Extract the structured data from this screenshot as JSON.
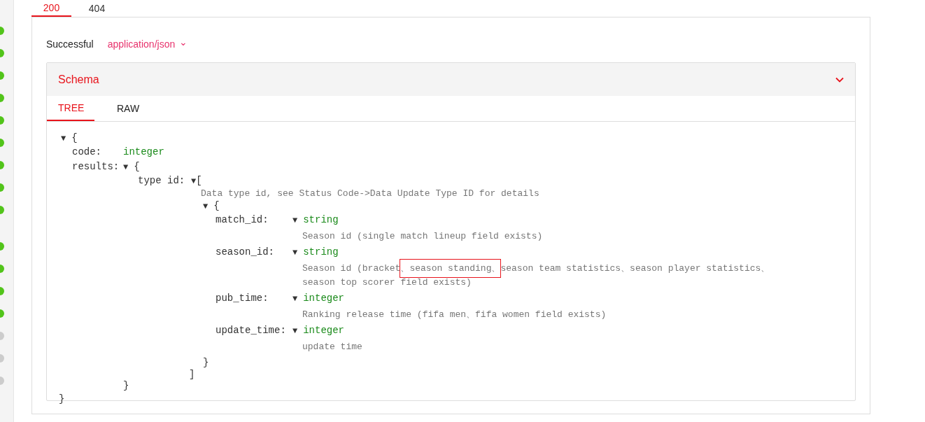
{
  "sidebar": {
    "dots": [
      {
        "color": "#52c41a"
      },
      {
        "color": "#52c41a"
      },
      {
        "color": "#52c41a"
      },
      {
        "color": "#52c41a"
      },
      {
        "color": "#52c41a"
      },
      {
        "color": "#52c41a"
      },
      {
        "color": "#52c41a"
      },
      {
        "color": "#52c41a"
      },
      {
        "color": "#52c41a"
      },
      {
        "color": "#52c41a"
      },
      {
        "color": "#52c41a"
      },
      {
        "color": "#52c41a"
      },
      {
        "color": "#52c41a"
      },
      {
        "color": "#cccccc"
      },
      {
        "color": "#cccccc"
      },
      {
        "color": "#cccccc"
      }
    ]
  },
  "response_tabs": [
    {
      "label": "200",
      "selected": true
    },
    {
      "label": "404",
      "selected": false
    }
  ],
  "response": {
    "status_text": "Successful",
    "content_type": "application/json",
    "content_type_caret": "⌄"
  },
  "schema": {
    "title": "Schema",
    "expanded": true,
    "view_tabs": [
      {
        "label": "TREE",
        "selected": true
      },
      {
        "label": "RAW",
        "selected": false
      }
    ],
    "tree": {
      "toggle": "▼",
      "open": "{",
      "close": "}",
      "fields": [
        {
          "kind": "scalar",
          "key": "code:",
          "type": "integer"
        },
        {
          "kind": "object",
          "key": "results:",
          "toggle": "▼",
          "open": "{",
          "close": "}",
          "fields": [
            {
              "kind": "array",
              "key": "type id:",
              "toggle": "▼",
              "open": "[",
              "close": "]",
              "description": [
                {
                  "text": "Data type id, see Status Code->Data Update Type ID for details",
                  "highlighted": false
                }
              ],
              "item": {
                "toggle": "▼",
                "open": "{",
                "close": "}",
                "fields": [
                  {
                    "kind": "scalar",
                    "key": "match_id:",
                    "toggle": "▼",
                    "type": "string",
                    "description": [
                      {
                        "text": "Season id (single match lineup field exists)",
                        "highlighted": false
                      }
                    ]
                  },
                  {
                    "kind": "scalar",
                    "key": "season_id:",
                    "toggle": "▼",
                    "type": "string",
                    "description": [
                      {
                        "text": "Season id (bracket",
                        "highlighted": false
                      },
                      {
                        "text": "、season standing、",
                        "highlighted": true
                      },
                      {
                        "text": "season team statistics、season player statistics、season top scorer field exists)",
                        "highlighted": false
                      }
                    ]
                  },
                  {
                    "kind": "scalar",
                    "key": "pub_time:",
                    "toggle": "▼",
                    "type": "integer",
                    "description": [
                      {
                        "text": "Ranking release time (fifa men、fifa women field exists)",
                        "highlighted": false
                      }
                    ]
                  },
                  {
                    "kind": "scalar",
                    "key": "update_time:",
                    "toggle": "▼",
                    "type": "integer",
                    "description": [
                      {
                        "text": "update time",
                        "highlighted": false
                      }
                    ]
                  }
                ]
              }
            }
          ]
        }
      ]
    }
  }
}
